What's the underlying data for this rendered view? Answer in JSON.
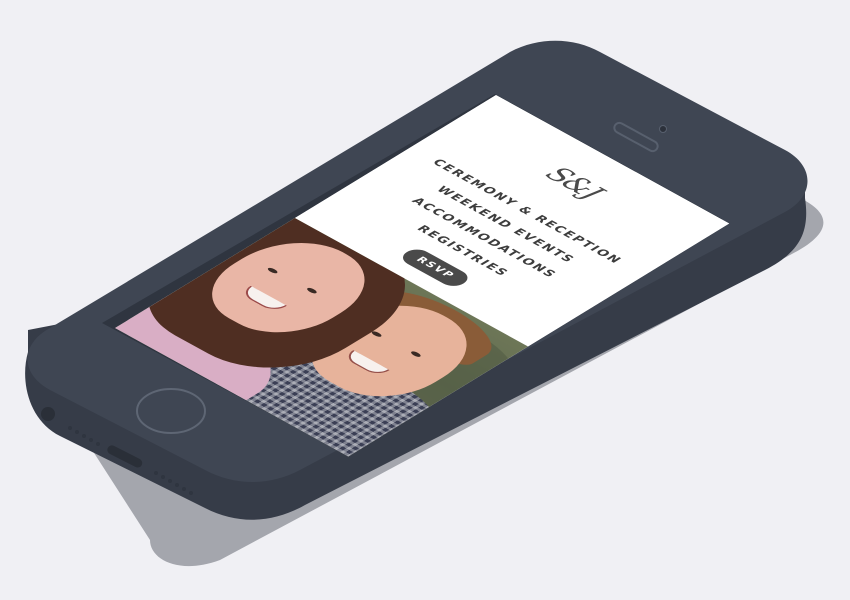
{
  "screen": {
    "monogram": "S&J",
    "nav": {
      "ceremony": "CEREMONY & RECEPTION",
      "weekend": "WEEKEND EVENTS",
      "accommodations": "ACCOMMODATIONS",
      "registries": "REGISTRIES",
      "rsvp": "RSVP"
    }
  },
  "colors": {
    "background": "#f0f0f4",
    "phone_body": "#3f4653",
    "phone_side": "#363c48",
    "nav_text": "#3d3d3d",
    "rsvp_button": "#4a4a4a"
  }
}
